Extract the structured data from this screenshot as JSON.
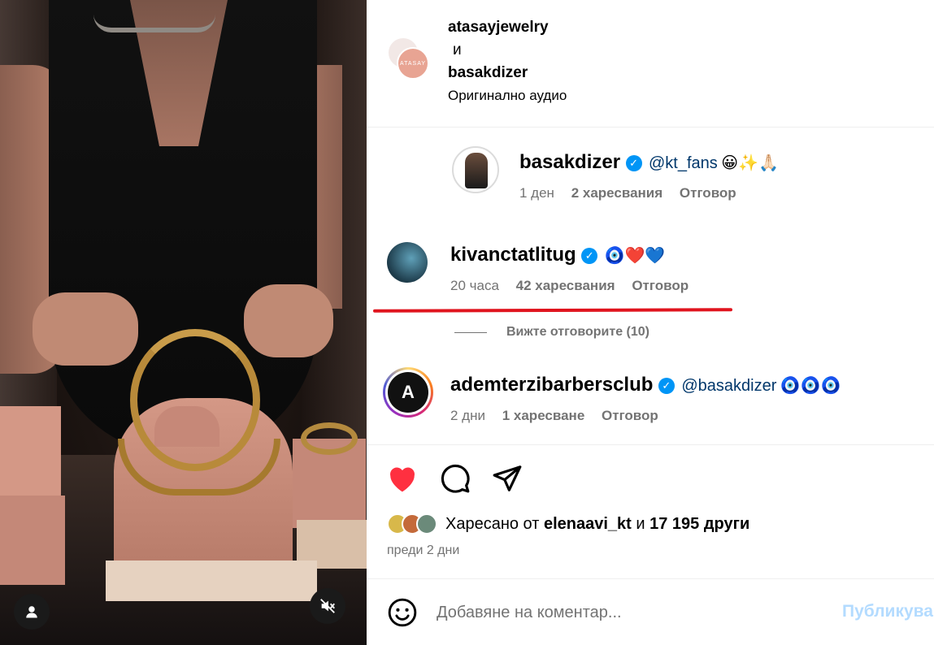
{
  "header": {
    "user1": "atasayjewelry",
    "and": "и",
    "user2": "basakdizer",
    "audio": "Оригинално аудио",
    "avatar_text": "ATASAY"
  },
  "comments": [
    {
      "username": "basakdizer",
      "verified": true,
      "mention": "@kt_fans",
      "emojis": "😀✨🙏🏻",
      "time": "1 ден",
      "likes": "2 харесвания",
      "reply": "Отговор"
    },
    {
      "username": "kivanctatlitug",
      "verified": true,
      "mention": "",
      "emojis": "🧿❤️💙",
      "time": "20 часа",
      "likes": "42 харесвания",
      "reply": "Отговор",
      "view_replies": "Вижте отговорите (10)"
    },
    {
      "username": "ademterzibarbersclub",
      "verified": true,
      "mention": "@basakdizer",
      "emojis": "🧿🧿🧿",
      "time": "2 дни",
      "likes": "1 харесване",
      "reply": "Отговор"
    }
  ],
  "actions": {
    "liked_by_prefix": "Харесано от",
    "liked_by_user": "elenaavi_kt",
    "liked_by_and": "и",
    "liked_by_others": "17 195 други",
    "posted_ago": "преди 2 дни"
  },
  "composer": {
    "placeholder": "Добавяне на коментар...",
    "post_label": "Публикувай"
  },
  "colors": {
    "like_red": "#ff3040",
    "link_blue": "#00376b",
    "verified_blue": "#0095f6",
    "annotation_red": "#e0141e"
  },
  "icons": [
    "user-icon",
    "muted-speaker-icon",
    "heart-icon",
    "comment-icon",
    "share-icon",
    "smile-icon",
    "verified-icon"
  ]
}
